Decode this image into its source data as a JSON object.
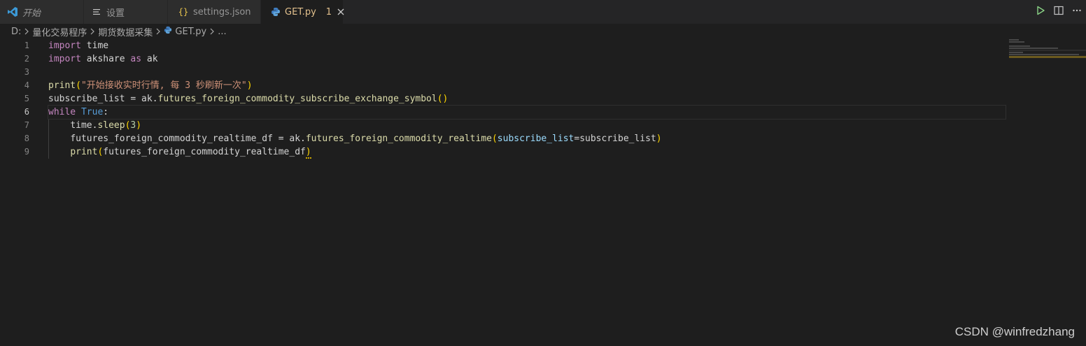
{
  "tabs": [
    {
      "label": "开始",
      "icon": "vscode-logo-icon"
    },
    {
      "label": "设置",
      "icon": "settings-lines-icon"
    },
    {
      "label": "settings.json",
      "icon": "json-braces-icon"
    },
    {
      "label": "GET.py",
      "icon": "python-icon",
      "problems": "1"
    }
  ],
  "breadcrumb": [
    "D:",
    "量化交易程序",
    "期货数据采集",
    "GET.py",
    "..."
  ],
  "line_numbers": [
    "1",
    "2",
    "3",
    "4",
    "5",
    "6",
    "7",
    "8",
    "9"
  ],
  "current_line": "6",
  "code": {
    "l1_import": "import",
    "l1_mod": " time",
    "l2_import": "import",
    "l2_mod": " akshare ",
    "l2_as": "as",
    "l2_alias": " ak",
    "l4_fn": "print",
    "l4_open": "(",
    "l4_str": "\"开始接收实时行情, 每 3 秒刷新一次\"",
    "l4_close": ")",
    "l5_a": "subscribe_list = ak.",
    "l5_fn": "futures_foreign_commodity_subscribe_exchange_symbol",
    "l5_parens": "()",
    "l6_while": "while",
    "l6_true": " True",
    "l6_colon": ":",
    "l7_indent": "    ",
    "l7_a": "time.",
    "l7_fn": "sleep",
    "l7_open": "(",
    "l7_num": "3",
    "l7_close": ")",
    "l8_indent": "    ",
    "l8_a": "futures_foreign_commodity_realtime_df = ak.",
    "l8_fn": "futures_foreign_commodity_realtime",
    "l8_open": "(",
    "l8_param": "subscribe_list",
    "l8_eq": "=subscribe_list",
    "l8_close": ")",
    "l9_indent": "    ",
    "l9_fn": "print",
    "l9_open": "(",
    "l9_arg": "futures_foreign_commodity_realtime_df",
    "l9_close": ")"
  },
  "watermark": "CSDN @winfredzhang",
  "colors": {
    "accent_modified": "#e2c08d",
    "editor_bg": "#1e1e1e",
    "tab_bg": "#2d2d2d"
  }
}
